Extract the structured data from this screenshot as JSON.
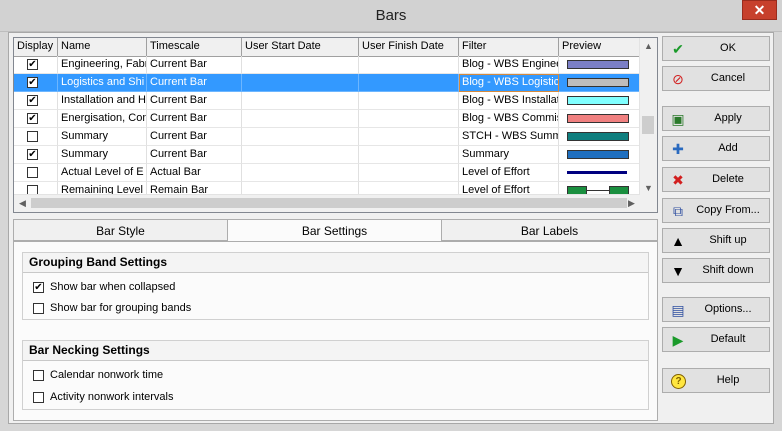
{
  "window": {
    "title": "Bars",
    "close_glyph": "✕"
  },
  "grid": {
    "columns": [
      "Display",
      "Name",
      "Timescale",
      "User Start Date",
      "User Finish Date",
      "Filter",
      "Preview"
    ],
    "rows": [
      {
        "checked": true,
        "name": "Engineering, Fabr",
        "timescale": "Current Bar",
        "start": "",
        "finish": "",
        "filter": "Blog - WBS Enginee",
        "preview": "#7b7fc6",
        "style": "bar"
      },
      {
        "checked": true,
        "name": "Logistics and Shi",
        "timescale": "Current Bar",
        "start": "",
        "finish": "",
        "filter": "Blog - WBS Logistic",
        "preview": "#bdbdbd",
        "style": "bar",
        "selected": true
      },
      {
        "checked": true,
        "name": "Installation and He",
        "timescale": "Current Bar",
        "start": "",
        "finish": "",
        "filter": "Blog - WBS Installat",
        "preview": "#80ffff",
        "style": "bar"
      },
      {
        "checked": true,
        "name": "Energisation, Con",
        "timescale": "Current Bar",
        "start": "",
        "finish": "",
        "filter": "Blog - WBS Commis",
        "preview": "#f08080",
        "style": "bar"
      },
      {
        "checked": false,
        "name": "Summary",
        "timescale": "Current Bar",
        "start": "",
        "finish": "",
        "filter": "STCH - WBS Summ",
        "preview": "#0f7f7f",
        "style": "bar"
      },
      {
        "checked": true,
        "name": "Summary",
        "timescale": "Current Bar",
        "start": "",
        "finish": "",
        "filter": "Summary",
        "preview": "#1f6fbf",
        "style": "bar"
      },
      {
        "checked": false,
        "name": "Actual Level of E",
        "timescale": "Actual Bar",
        "start": "",
        "finish": "",
        "filter": "Level of Effort",
        "preview": "#000080",
        "style": "thin"
      },
      {
        "checked": false,
        "name": "Remaining Level o",
        "timescale": "Remain Bar",
        "start": "",
        "finish": "",
        "filter": "Level of Effort",
        "preview": "#1a8f3f",
        "style": "ends"
      }
    ]
  },
  "tabs": [
    "Bar Style",
    "Bar Settings",
    "Bar Labels"
  ],
  "active_tab": 1,
  "grouping": {
    "title": "Grouping Band Settings",
    "options": [
      {
        "label": "Show bar when collapsed",
        "checked": true
      },
      {
        "label": "Show bar for grouping bands",
        "checked": false
      }
    ]
  },
  "necking": {
    "title": "Bar Necking Settings",
    "options": [
      {
        "label": "Calendar nonwork time",
        "checked": false
      },
      {
        "label": "Activity nonwork intervals",
        "checked": false
      }
    ]
  },
  "buttons": [
    {
      "label": "OK",
      "icon": "check-icon",
      "glyph": "✔",
      "color": "#1a9a2a"
    },
    {
      "label": "Cancel",
      "icon": "cancel-icon",
      "glyph": "⊘",
      "color": "#d21f1f"
    },
    {
      "label": "Apply",
      "icon": "apply-icon",
      "glyph": "▣",
      "color": "#2a7a2a"
    },
    {
      "label": "Add",
      "icon": "add-icon",
      "glyph": "✚",
      "color": "#2a6abf"
    },
    {
      "label": "Delete",
      "icon": "delete-icon",
      "glyph": "✖",
      "color": "#d21f1f"
    },
    {
      "label": "Copy From...",
      "icon": "copy-icon",
      "glyph": "⧉",
      "color": "#3050a0"
    },
    {
      "label": "Shift up",
      "icon": "shift-up-icon",
      "glyph": "▲",
      "color": "#000000"
    },
    {
      "label": "Shift down",
      "icon": "shift-down-icon",
      "glyph": "▼",
      "color": "#000000"
    },
    {
      "label": "Options...",
      "icon": "options-icon",
      "glyph": "▤",
      "color": "#3050a0"
    },
    {
      "label": "Default",
      "icon": "default-icon",
      "glyph": "▶",
      "color": "#1a9a2a"
    },
    {
      "label": "Help",
      "icon": "help-icon",
      "glyph": "?",
      "color": "#806000"
    }
  ]
}
